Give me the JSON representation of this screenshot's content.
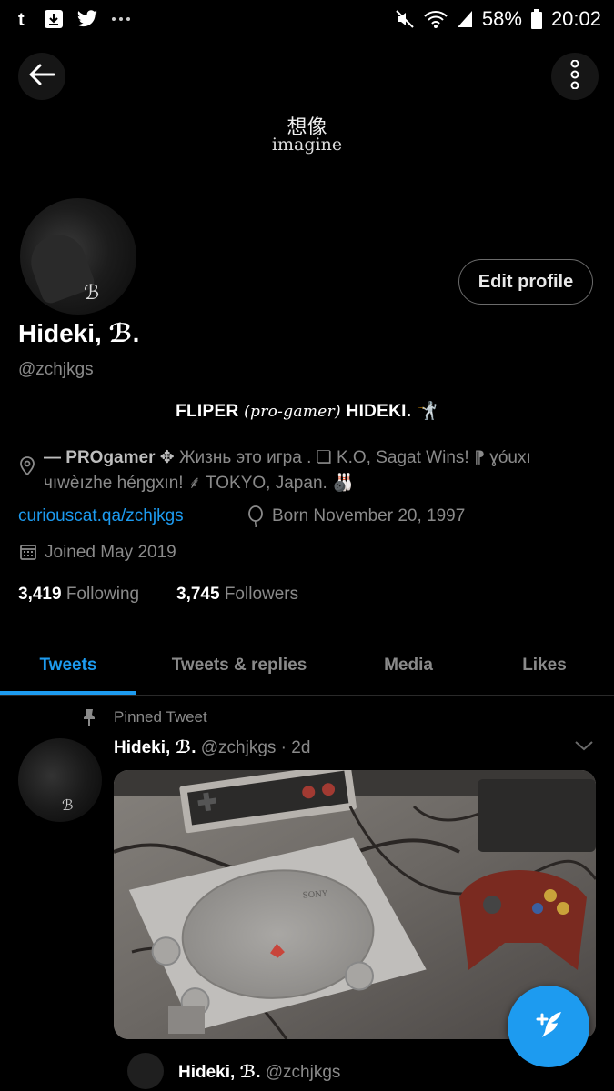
{
  "status_bar": {
    "battery": "58%",
    "time": "20:02",
    "icons": [
      "tumblr-icon",
      "download-icon",
      "twitter-icon",
      "more-dots-icon",
      "mute-icon",
      "wifi-icon",
      "signal-icon",
      "battery-icon"
    ]
  },
  "header": {
    "banner_title_jp": "想像",
    "banner_title_en": "imagine"
  },
  "profile": {
    "avatar_mark": "ℬ",
    "name": "Hideki, ℬ.",
    "handle": "@zchjkgs",
    "edit_button": "Edit profile",
    "bio_line_a": "FLIPER",
    "bio_line_b": "(pro-gamer)",
    "bio_line_c": "HIDEKI. 🤺",
    "location_line1_bold": "— PROgamer ✥",
    "location_line1_rest": " Жизнь это игра . ❏ K.O, Sagat Wins! ⁋ ɣóuxı",
    "location_line2": "чıwèızhe héŋgxın! ⸙ TOKYO, Japan. 🎳",
    "website": "curiouscat.qa/zchjkgs",
    "born": "Born November 20, 1997",
    "joined": "Joined May 2019",
    "following_count": "3,419",
    "following_label": "Following",
    "followers_count": "3,745",
    "followers_label": "Followers"
  },
  "tabs": [
    {
      "label": "Tweets",
      "active": true
    },
    {
      "label": "Tweets & replies",
      "active": false
    },
    {
      "label": "Media",
      "active": false
    },
    {
      "label": "Likes",
      "active": false
    }
  ],
  "pinned_tweet": {
    "pinned_label": "Pinned Tweet",
    "name": "Hideki, ℬ.",
    "handle_time": "@zchjkgs · 2d",
    "avatar_mark": "ℬ",
    "media_description_brand": "SONY",
    "quote_name": "Hideki, ℬ.",
    "quote_handle": "@zchjkgs"
  },
  "colors": {
    "accent": "#1d9bf0",
    "background": "#000000",
    "secondary_text": "#8a8a8a"
  }
}
